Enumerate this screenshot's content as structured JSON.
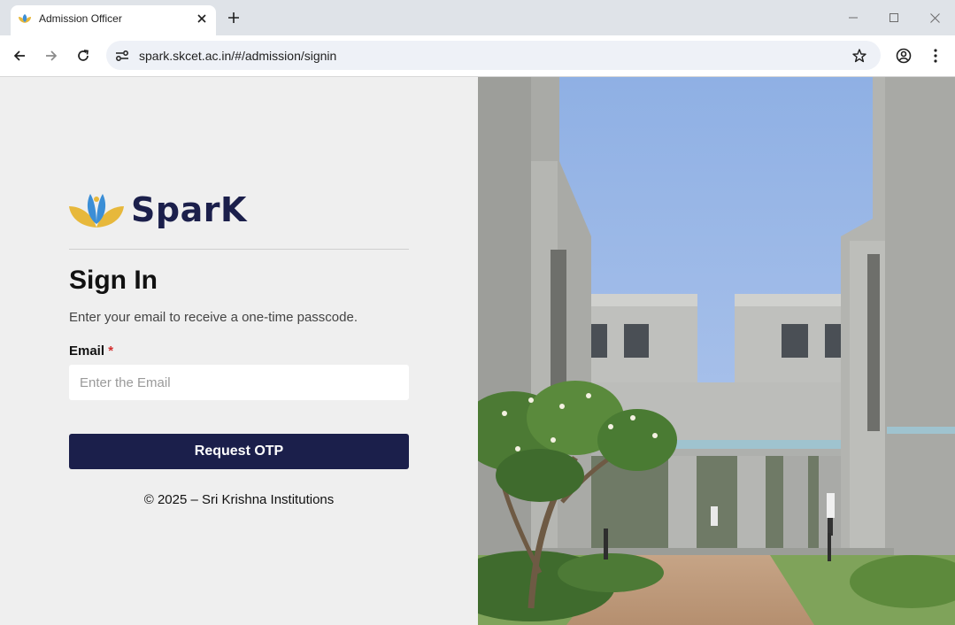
{
  "browser": {
    "tab_title": "Admission Officer",
    "url": "spark.skcet.ac.in/#/admission/signin"
  },
  "brand": {
    "name": "SparK",
    "navy": "#1b1f4b",
    "gold": "#e7b83b",
    "blue": "#3b8ed6"
  },
  "signin": {
    "title": "Sign In",
    "subtitle": "Enter your email to receive a one-time passcode.",
    "email_label": "Email",
    "required_mark": "*",
    "email_placeholder": "Enter the Email",
    "email_value": "",
    "button_label": "Request OTP",
    "footer": "© 2025 – Sri Krishna Institutions"
  },
  "icons": [
    "favicon-icon",
    "close-icon",
    "plus-icon",
    "minimize-icon",
    "maximize-icon",
    "window-close-icon",
    "back-arrow-icon",
    "forward-arrow-icon",
    "reload-icon",
    "site-settings-icon",
    "star-icon",
    "profile-icon",
    "kebab-menu-icon",
    "spark-logo-icon"
  ]
}
